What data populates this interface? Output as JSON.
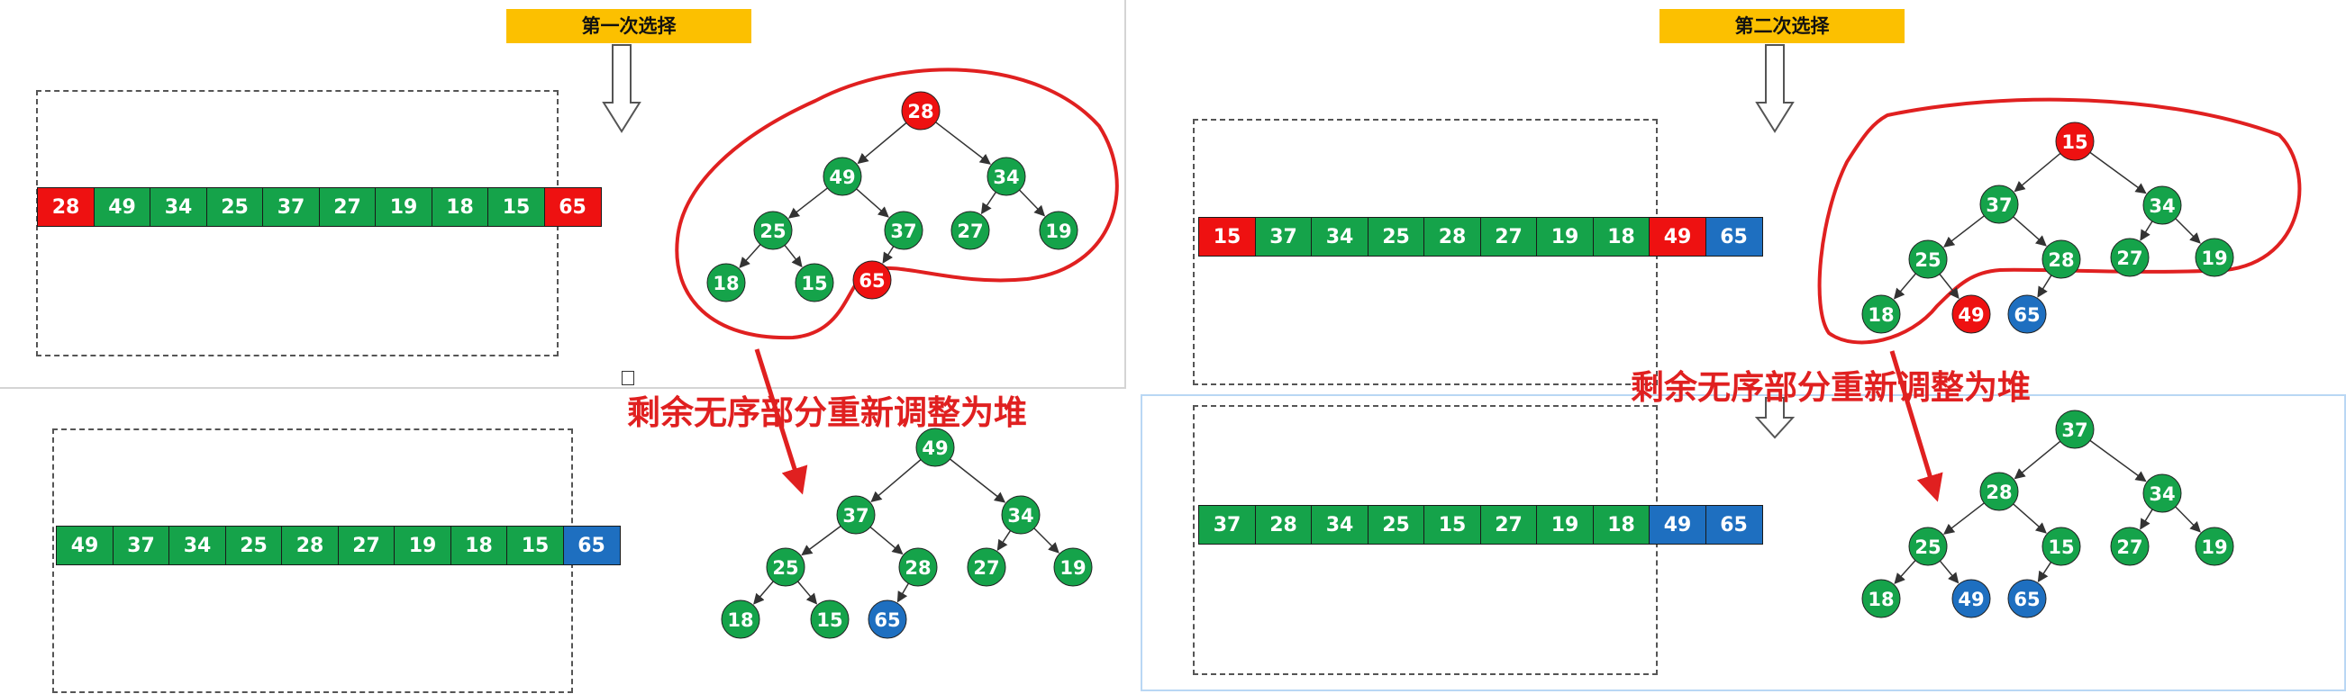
{
  "colors": {
    "red": "#ee1111",
    "green": "#15a34a",
    "blue": "#1e6fc0",
    "yellow": "#fcc000",
    "annotation": "#e02020"
  },
  "captions": {
    "rebuild_heap": "剩余无序部分重新调整为堆"
  },
  "panels": [
    {
      "title": "第一次选择",
      "before": {
        "array": [
          {
            "v": "28",
            "c": "red"
          },
          {
            "v": "49",
            "c": "green"
          },
          {
            "v": "34",
            "c": "green"
          },
          {
            "v": "25",
            "c": "green"
          },
          {
            "v": "37",
            "c": "green"
          },
          {
            "v": "27",
            "c": "green"
          },
          {
            "v": "19",
            "c": "green"
          },
          {
            "v": "18",
            "c": "green"
          },
          {
            "v": "15",
            "c": "green"
          },
          {
            "v": "65",
            "c": "red"
          }
        ],
        "tree": [
          {
            "v": "28",
            "c": "red"
          },
          {
            "v": "49",
            "c": "green"
          },
          {
            "v": "34",
            "c": "green"
          },
          {
            "v": "25",
            "c": "green"
          },
          {
            "v": "37",
            "c": "green"
          },
          {
            "v": "27",
            "c": "green"
          },
          {
            "v": "19",
            "c": "green"
          },
          {
            "v": "18",
            "c": "green"
          },
          {
            "v": "15",
            "c": "green"
          },
          {
            "v": "65",
            "c": "red"
          }
        ]
      },
      "after": {
        "array": [
          {
            "v": "49",
            "c": "green"
          },
          {
            "v": "37",
            "c": "green"
          },
          {
            "v": "34",
            "c": "green"
          },
          {
            "v": "25",
            "c": "green"
          },
          {
            "v": "28",
            "c": "green"
          },
          {
            "v": "27",
            "c": "green"
          },
          {
            "v": "19",
            "c": "green"
          },
          {
            "v": "18",
            "c": "green"
          },
          {
            "v": "15",
            "c": "green"
          },
          {
            "v": "65",
            "c": "blue"
          }
        ],
        "tree": [
          {
            "v": "49",
            "c": "green"
          },
          {
            "v": "37",
            "c": "green"
          },
          {
            "v": "34",
            "c": "green"
          },
          {
            "v": "25",
            "c": "green"
          },
          {
            "v": "28",
            "c": "green"
          },
          {
            "v": "27",
            "c": "green"
          },
          {
            "v": "19",
            "c": "green"
          },
          {
            "v": "18",
            "c": "green"
          },
          {
            "v": "15",
            "c": "green"
          },
          {
            "v": "65",
            "c": "blue"
          }
        ]
      }
    },
    {
      "title": "第二次选择",
      "before": {
        "array": [
          {
            "v": "15",
            "c": "red"
          },
          {
            "v": "37",
            "c": "green"
          },
          {
            "v": "34",
            "c": "green"
          },
          {
            "v": "25",
            "c": "green"
          },
          {
            "v": "28",
            "c": "green"
          },
          {
            "v": "27",
            "c": "green"
          },
          {
            "v": "19",
            "c": "green"
          },
          {
            "v": "18",
            "c": "green"
          },
          {
            "v": "49",
            "c": "red"
          },
          {
            "v": "65",
            "c": "blue"
          }
        ],
        "tree": [
          {
            "v": "15",
            "c": "red"
          },
          {
            "v": "37",
            "c": "green"
          },
          {
            "v": "34",
            "c": "green"
          },
          {
            "v": "25",
            "c": "green"
          },
          {
            "v": "28",
            "c": "green"
          },
          {
            "v": "27",
            "c": "green"
          },
          {
            "v": "19",
            "c": "green"
          },
          {
            "v": "18",
            "c": "green"
          },
          {
            "v": "49",
            "c": "red"
          },
          {
            "v": "65",
            "c": "blue"
          }
        ]
      },
      "after": {
        "array": [
          {
            "v": "37",
            "c": "green"
          },
          {
            "v": "28",
            "c": "green"
          },
          {
            "v": "34",
            "c": "green"
          },
          {
            "v": "25",
            "c": "green"
          },
          {
            "v": "15",
            "c": "green"
          },
          {
            "v": "27",
            "c": "green"
          },
          {
            "v": "19",
            "c": "green"
          },
          {
            "v": "18",
            "c": "green"
          },
          {
            "v": "49",
            "c": "blue"
          },
          {
            "v": "65",
            "c": "blue"
          }
        ],
        "tree": [
          {
            "v": "37",
            "c": "green"
          },
          {
            "v": "28",
            "c": "green"
          },
          {
            "v": "34",
            "c": "green"
          },
          {
            "v": "25",
            "c": "green"
          },
          {
            "v": "15",
            "c": "green"
          },
          {
            "v": "27",
            "c": "green"
          },
          {
            "v": "19",
            "c": "green"
          },
          {
            "v": "18",
            "c": "green"
          },
          {
            "v": "49",
            "c": "blue"
          },
          {
            "v": "65",
            "c": "blue"
          }
        ]
      }
    }
  ]
}
